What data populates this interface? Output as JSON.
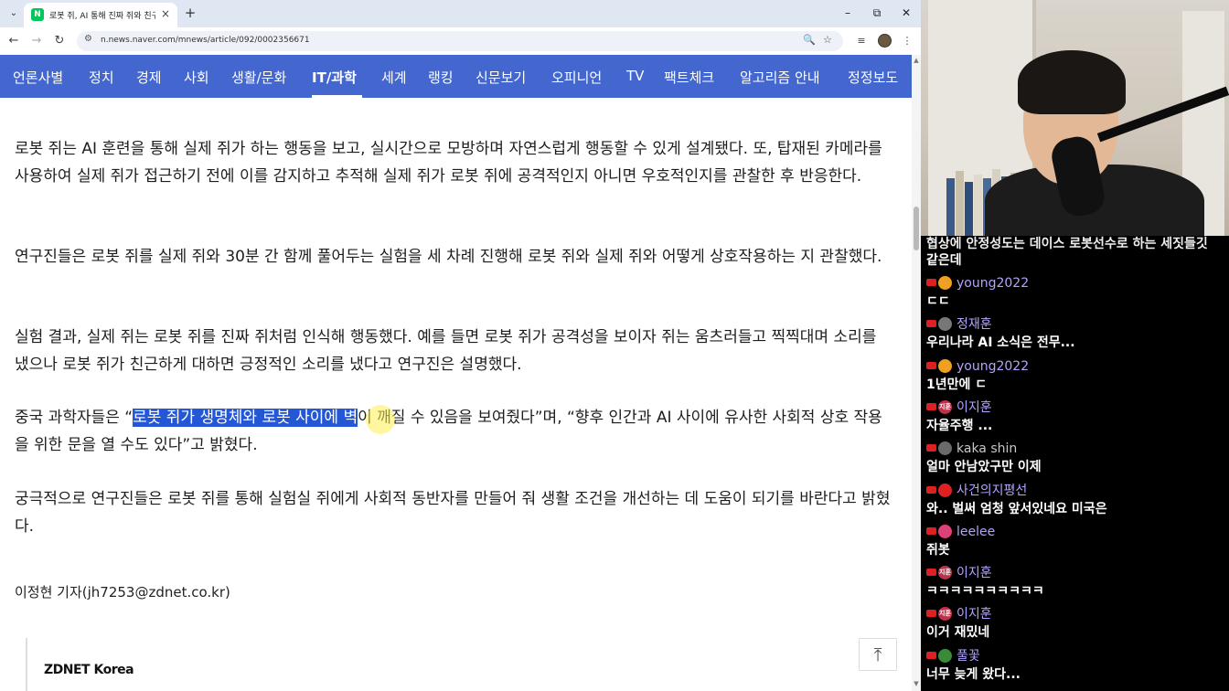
{
  "browser": {
    "tab": {
      "favicon": "N",
      "title": "로봇 쥐, AI 통해 진짜 쥐와 친구",
      "close_icon": "×"
    },
    "new_tab_icon": "+",
    "dropdown_icon": "⌄",
    "window_controls": {
      "minimize": "–",
      "maximize": "⧉",
      "close": "✕"
    },
    "nav": {
      "back": "←",
      "forward": "→",
      "reload": "↻",
      "site_info": "⚙"
    },
    "url": "n.news.naver.com/mnews/article/092/0002356671",
    "omnibox_icons": {
      "zoom": "🔍",
      "bookmark": "☆"
    },
    "toolbar_icons": {
      "media": "≡",
      "menu": "⋮"
    }
  },
  "categories": {
    "items": [
      "언론사별",
      "정치",
      "경제",
      "사회",
      "생활/문화",
      "IT/과학",
      "세계",
      "랭킹",
      "신문보기",
      "오피니언",
      "TV",
      "팩트체크",
      "알고리즘 안내",
      "정정보도"
    ],
    "active": "IT/과학"
  },
  "article": {
    "p1": "로봇 쥐는 AI 훈련을 통해 실제 쥐가 하는 행동을 보고, 실시간으로 모방하며 자연스럽게 행동할 수 있게 설계됐다. 또, 탑재된 카메라를 사용하여 실제 쥐가 접근하기 전에 이를 감지하고 추적해 실제 쥐가 로봇 쥐에 공격적인지 아니면 우호적인지를 관찰한 후 반응한다.",
    "p2": "연구진들은 로봇 쥐를 실제 쥐와 30분 간 함께 풀어두는 실험을 세 차례 진행해 로봇 쥐와 실제 쥐와 어떻게 상호작용하는 지 관찰했다.",
    "p3": "실험 결과, 실제 쥐는 로봇 쥐를 진짜 쥐처럼 인식해 행동했다. 예를 들면 로봇 쥐가 공격성을 보이자 쥐는 움츠러들고 찍찍대며 소리를 냈으나 로봇 쥐가 친근하게 대하면 긍정적인 소리를 냈다고 연구진은 설명했다.",
    "p4_before": "중국 과학자들은 “",
    "p4_highlight": "로봇 쥐가 생명체와 로봇 사이에 벽",
    "p4_after": "이 깨질 수 있음을 보여줬다”며, “향후 인간과 AI 사이에 유사한 사회적 상호 작용을 위한 문을 열 수도 있다”고 밝혔다.",
    "p5": "궁극적으로 연구진들은 로봇 쥐를 통해 실험실 쥐에게 사회적 동반자를 만들어 줘 생활 조건을 개선하는 데 도움이 되기를 바란다고 밝혔다.",
    "byline": "이정현 기자(jh7253@zdnet.co.kr)",
    "publisher": "ZDNET Korea",
    "top_button_icon": "⤒"
  },
  "scrollbar": {
    "up": "▲",
    "down": "▼"
  },
  "chat": {
    "partial_top_line": "협상에 안정성도는 데이스 로봇선수로 하는 세짓들깃",
    "partial_top_line2": "같은데",
    "messages": [
      {
        "author": "young2022",
        "badge": "",
        "badge_color": "#f0a020",
        "author_color": "#b4a3ff",
        "text": "ㄷㄷ"
      },
      {
        "author": "정재훈",
        "badge": "",
        "badge_color": "#777777",
        "author_color": "#b4a3ff",
        "text": "우리나라 AI 소식은 전무..."
      },
      {
        "author": "young2022",
        "badge": "",
        "badge_color": "#f0a020",
        "author_color": "#b4a3ff",
        "text": "1년만에 ㄷ"
      },
      {
        "author": "이지훈",
        "badge": "지훈",
        "badge_color": "#c0304a",
        "author_color": "#b4a3ff",
        "text": "자율주행 ..."
      },
      {
        "author": "kaka shin",
        "badge": "",
        "badge_color": "#6a6a6a",
        "author_color": "#c8c8c8",
        "text": "얼마 안남았구만 이제"
      },
      {
        "author": "사건의지평선",
        "badge": "",
        "badge_color": "#e02020",
        "author_color": "#b4a3ff",
        "text": "와.. 벌써 엄청 앞서있네요 미국은"
      },
      {
        "author": "leelee",
        "badge": "",
        "badge_color": "#e0407a",
        "author_color": "#b4a3ff",
        "text": "쥐봇"
      },
      {
        "author": "이지훈",
        "badge": "지훈",
        "badge_color": "#c0304a",
        "author_color": "#b4a3ff",
        "text": "ㅋㅋㅋㅋㅋㅋㅋㅋㅋㅋ"
      },
      {
        "author": "이지훈",
        "badge": "지훈",
        "badge_color": "#c0304a",
        "author_color": "#b4a3ff",
        "text": "이거 재밌네"
      },
      {
        "author": "풀꽃",
        "badge": "",
        "badge_color": "#3a8a3a",
        "author_color": "#b4a3ff",
        "text": "너무 늦게 왔다..."
      }
    ]
  },
  "colors": {
    "category_bar": "#4467cf",
    "highlight": "#2457d6",
    "tabbar": "#dfe7f3",
    "youtube_red": "#e02020"
  }
}
